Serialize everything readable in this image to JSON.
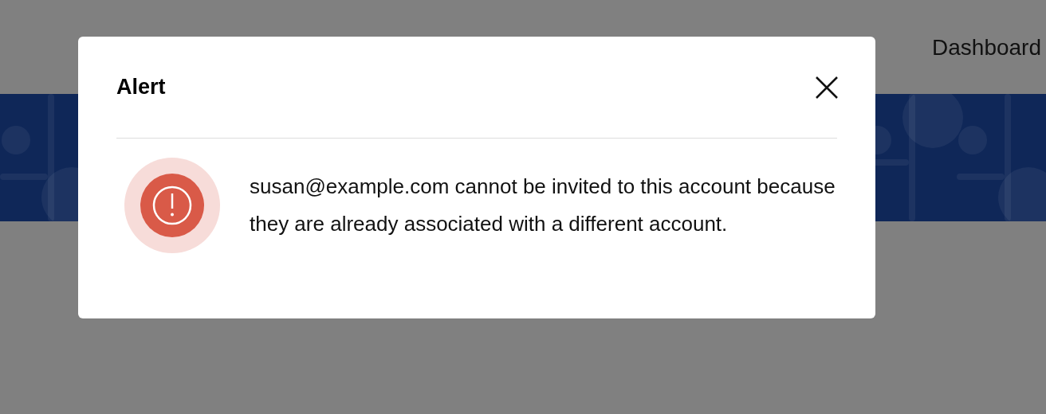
{
  "header": {
    "nav_link": "Dashboard"
  },
  "dialog": {
    "title": "Alert",
    "message": "susan@example.com cannot be invited to this account because they are already associated with a different account."
  }
}
